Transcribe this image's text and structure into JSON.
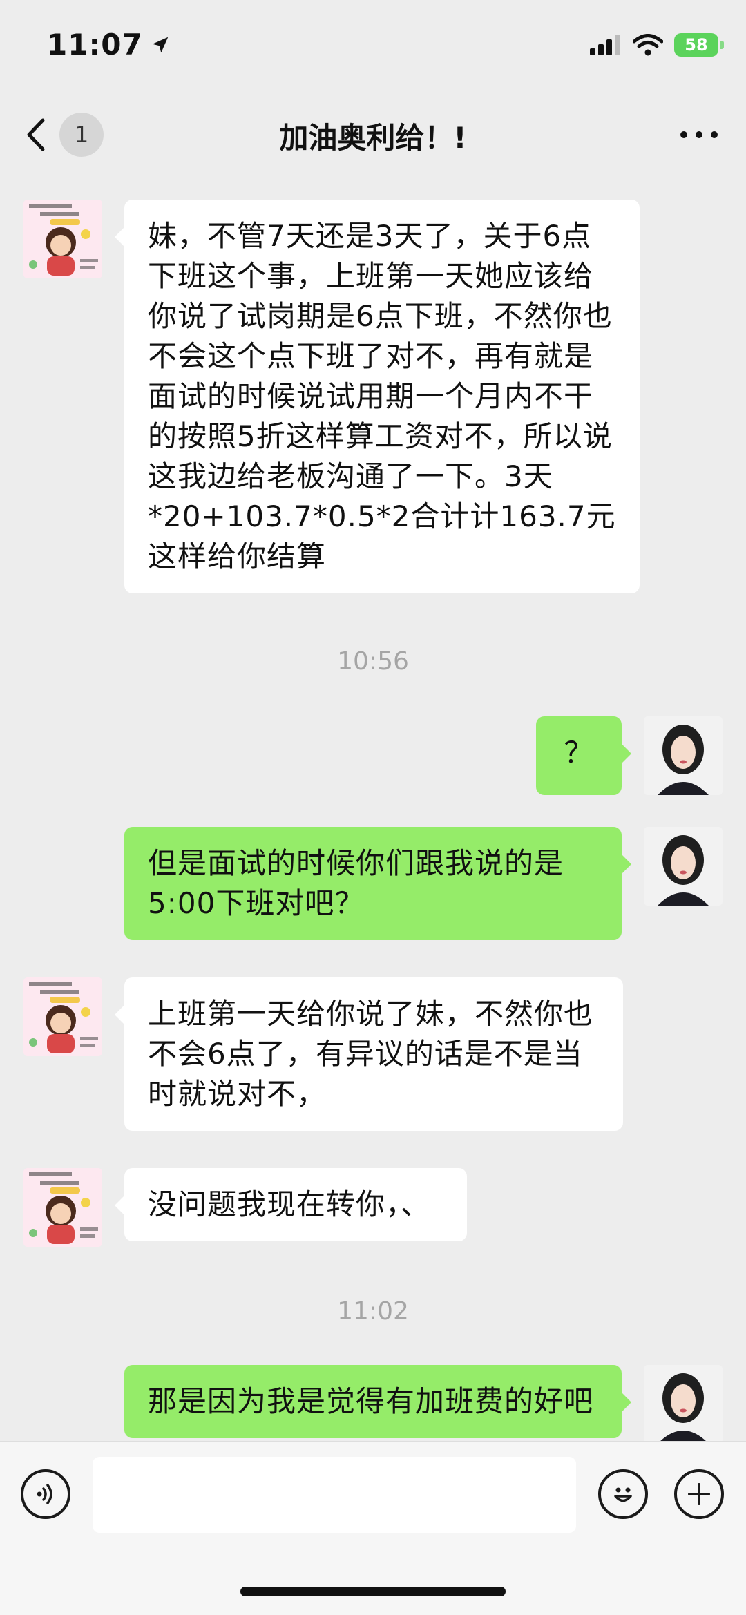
{
  "status_bar": {
    "time": "11:07",
    "battery": "58"
  },
  "header": {
    "unread_count": "1",
    "title": "加油奥利给！!"
  },
  "messages": [
    {
      "side": "left",
      "text": "妹，不管7天还是3天了，关于6点下班这个事，上班第一天她应该给你说了试岗期是6点下班，不然你也不会这个点下班了对不，再有就是面试的时候说试用期一个月内不干的按照5折这样算工资对不，所以说这我边给老板沟通了一下。3天*20+103.7*0.5*2合计计163.7元这样给你结算"
    },
    {
      "timestamp": "10:56"
    },
    {
      "side": "right",
      "text": "？"
    },
    {
      "side": "right",
      "text": "但是面试的时候你们跟我说的是5:00下班对吧？"
    },
    {
      "side": "left",
      "text": "上班第一天给你说了妹，不然你也不会6点了，有异议的话是不是当时就说对不，"
    },
    {
      "side": "left",
      "text": "没问题我现在转你，、"
    },
    {
      "timestamp": "11:02"
    },
    {
      "side": "right",
      "text": "那是因为我是觉得有加班费的好吧"
    }
  ],
  "input": {
    "placeholder": ""
  },
  "icons": {
    "voice": "voice-icon",
    "emoji": "emoji-icon",
    "plus": "plus-icon",
    "back": "chevron-left-icon",
    "more": "more-dots-icon"
  }
}
